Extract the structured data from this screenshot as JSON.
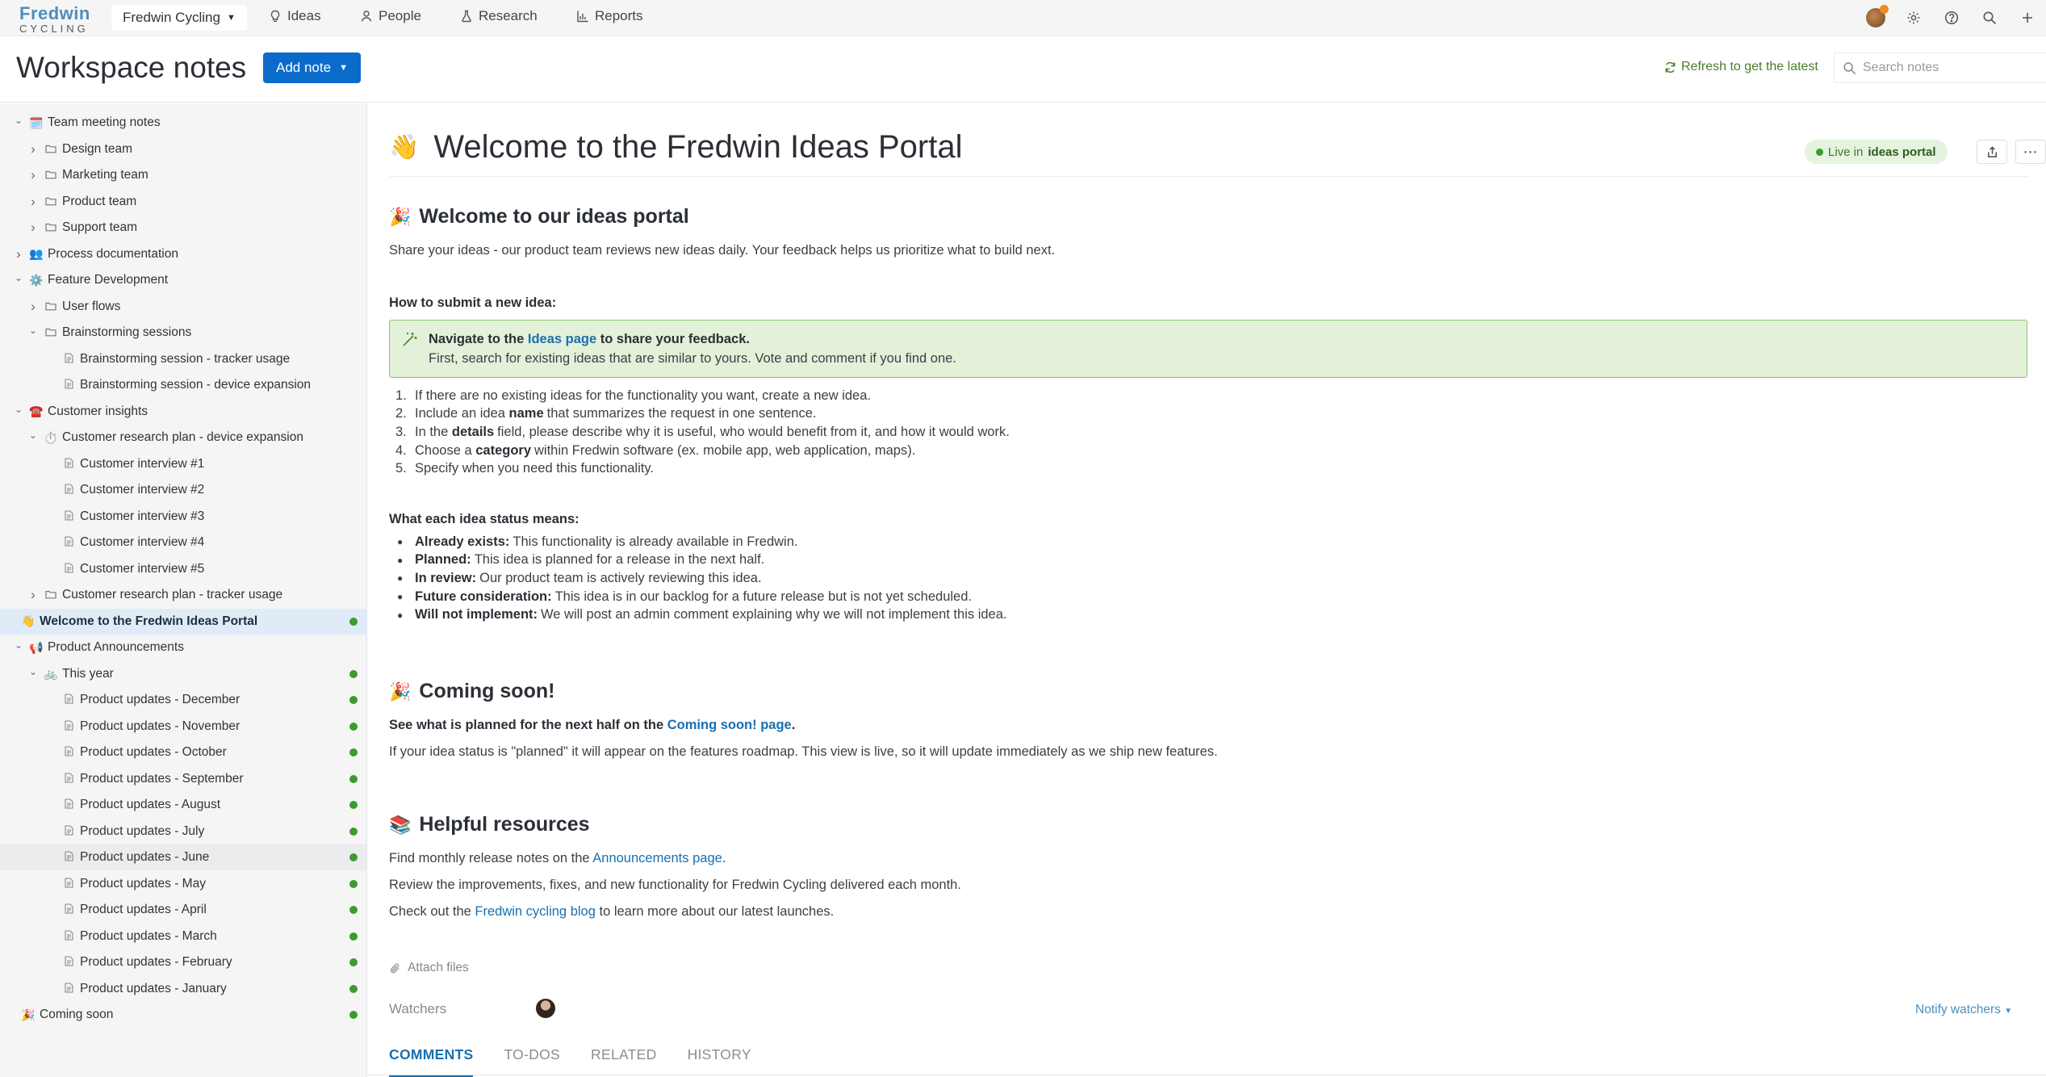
{
  "nav": {
    "logo_line1": "Fredwin",
    "logo_line2": "CYCLING",
    "workspace": "Fredwin Cycling",
    "items": [
      {
        "label": "Ideas",
        "icon": "lightbulb-icon"
      },
      {
        "label": "People",
        "icon": "person-icon"
      },
      {
        "label": "Research",
        "icon": "flask-icon"
      },
      {
        "label": "Reports",
        "icon": "bar-chart-icon"
      }
    ]
  },
  "header": {
    "title": "Workspace notes",
    "add_note": "Add note",
    "refresh": "Refresh to get the latest",
    "search_placeholder": "Search notes"
  },
  "sidebar": {
    "items": [
      {
        "label": "Team meeting notes",
        "level": 0,
        "chev": "down",
        "icon": "🗓️",
        "live": false
      },
      {
        "label": "Design team",
        "level": 1,
        "chev": "right",
        "icon": "folder",
        "live": false
      },
      {
        "label": "Marketing team",
        "level": 1,
        "chev": "right",
        "icon": "folder",
        "live": false
      },
      {
        "label": "Product team",
        "level": 1,
        "chev": "right",
        "icon": "folder",
        "live": false
      },
      {
        "label": "Support team",
        "level": 1,
        "chev": "right",
        "icon": "folder",
        "live": false
      },
      {
        "label": "Process documentation",
        "level": 0,
        "chev": "right",
        "icon": "👥",
        "live": false
      },
      {
        "label": "Feature Development",
        "level": 0,
        "chev": "down",
        "icon": "⚙️",
        "live": false
      },
      {
        "label": "User flows",
        "level": 1,
        "chev": "right",
        "icon": "folder",
        "live": false
      },
      {
        "label": "Brainstorming sessions",
        "level": 1,
        "chev": "down",
        "icon": "folder",
        "live": false
      },
      {
        "label": "Brainstorming session - tracker usage",
        "level": 2,
        "chev": "",
        "icon": "doc",
        "live": false
      },
      {
        "label": "Brainstorming session - device expansion",
        "level": 2,
        "chev": "",
        "icon": "doc",
        "live": false
      },
      {
        "label": "Customer insights",
        "level": 0,
        "chev": "down",
        "icon": "☎️",
        "live": false
      },
      {
        "label": "Customer research plan - device expansion",
        "level": 1,
        "chev": "down",
        "icon": "⏱️",
        "live": false
      },
      {
        "label": "Customer interview #1",
        "level": 2,
        "chev": "",
        "icon": "doc",
        "live": false
      },
      {
        "label": "Customer interview #2",
        "level": 2,
        "chev": "",
        "icon": "doc",
        "live": false
      },
      {
        "label": "Customer interview #3",
        "level": 2,
        "chev": "",
        "icon": "doc",
        "live": false
      },
      {
        "label": "Customer interview #4",
        "level": 2,
        "chev": "",
        "icon": "doc",
        "live": false
      },
      {
        "label": "Customer interview #5",
        "level": 2,
        "chev": "",
        "icon": "doc",
        "live": false
      },
      {
        "label": "Customer research plan - tracker usage",
        "level": 1,
        "chev": "right",
        "icon": "folder",
        "live": false
      },
      {
        "label": "Welcome to the Fredwin Ideas Portal",
        "level": 0,
        "chev": "",
        "icon": "👋",
        "live": true,
        "selected": true
      },
      {
        "label": "Product Announcements",
        "level": 0,
        "chev": "down",
        "icon": "📢",
        "live": false
      },
      {
        "label": "This year",
        "level": 1,
        "chev": "down",
        "icon": "🚲",
        "live": true
      },
      {
        "label": "Product updates - December",
        "level": 2,
        "chev": "",
        "icon": "doc",
        "live": true
      },
      {
        "label": "Product updates - November",
        "level": 2,
        "chev": "",
        "icon": "doc",
        "live": true
      },
      {
        "label": "Product updates - October",
        "level": 2,
        "chev": "",
        "icon": "doc",
        "live": true
      },
      {
        "label": "Product updates - September",
        "level": 2,
        "chev": "",
        "icon": "doc",
        "live": true
      },
      {
        "label": "Product updates - August",
        "level": 2,
        "chev": "",
        "icon": "doc",
        "live": true
      },
      {
        "label": "Product updates - July",
        "level": 2,
        "chev": "",
        "icon": "doc",
        "live": true
      },
      {
        "label": "Product updates - June",
        "level": 2,
        "chev": "",
        "icon": "doc",
        "live": true,
        "hover": true
      },
      {
        "label": "Product updates - May",
        "level": 2,
        "chev": "",
        "icon": "doc",
        "live": true
      },
      {
        "label": "Product updates - April",
        "level": 2,
        "chev": "",
        "icon": "doc",
        "live": true
      },
      {
        "label": "Product updates - March",
        "level": 2,
        "chev": "",
        "icon": "doc",
        "live": true
      },
      {
        "label": "Product updates - February",
        "level": 2,
        "chev": "",
        "icon": "doc",
        "live": true
      },
      {
        "label": "Product updates - January",
        "level": 2,
        "chev": "",
        "icon": "doc",
        "live": true
      },
      {
        "label": "Coming soon",
        "level": 0,
        "chev": "",
        "icon": "🎉",
        "live": true
      }
    ]
  },
  "doc": {
    "title_emoji": "👋",
    "title": "Welcome to the Fredwin Ideas Portal",
    "live_prefix": "Live in",
    "live_target": "ideas portal",
    "section1_emoji": "🎉",
    "section1": "Welcome to our ideas portal",
    "intro": "Share your ideas - our product team reviews new ideas daily. Your feedback helps us prioritize what to build next.",
    "how_heading": "How to submit a new idea:",
    "callout_pre": "Navigate to the",
    "callout_link": "Ideas page",
    "callout_post": "to share your feedback.",
    "callout_line2": "First, search for existing ideas that are similar to yours. Vote and comment if you find one.",
    "steps": [
      {
        "n": "1.",
        "pre": "If there are no existing ideas for the functionality you want, create a new idea.",
        "bold": "",
        "post": ""
      },
      {
        "n": "2.",
        "pre": "Include an idea",
        "bold": "name",
        "post": "that summarizes the request in one sentence."
      },
      {
        "n": "3.",
        "pre": "In the",
        "bold": "details",
        "post": "field, please describe why it is useful, who would benefit from it, and how it would work."
      },
      {
        "n": "4.",
        "pre": "Choose a",
        "bold": "category",
        "post": "within Fredwin software (ex. mobile app, web application, maps)."
      },
      {
        "n": "5.",
        "pre": "Specify when you need this functionality.",
        "bold": "",
        "post": ""
      }
    ],
    "status_heading": "What each idea status means:",
    "statuses": [
      {
        "term": "Already exists:",
        "desc": "This functionality is already available in Fredwin."
      },
      {
        "term": "Planned:",
        "desc": "This idea is planned for a release in the next half."
      },
      {
        "term": "In review:",
        "desc": "Our product team is actively reviewing this idea."
      },
      {
        "term": "Future consideration:",
        "desc": "This idea is in our backlog for a future release but is not yet scheduled."
      },
      {
        "term": "Will not implement:",
        "desc": "We will post an admin comment explaining why we will not implement this idea."
      }
    ],
    "section2_emoji": "🎉",
    "section2": "Coming soon!",
    "coming_pre": "See what is planned for the next half on the",
    "coming_link": "Coming soon! page",
    "coming_post": ".",
    "coming_line2": "If your idea status is \"planned\" it will appear on the features roadmap. This view is live, so it will update immediately as we ship new features.",
    "section3_emoji": "📚",
    "section3": "Helpful resources",
    "res1_pre": "Find monthly release notes on the",
    "res1_link": "Announcements page",
    "res1_post": ".",
    "res2": "Review the improvements, fixes, and new functionality for Fredwin Cycling delivered each month.",
    "res3_pre": "Check out the",
    "res3_link": "Fredwin cycling blog",
    "res3_post": "to learn more about our latest launches.",
    "attach": "Attach files",
    "watchers": "Watchers",
    "notify": "Notify watchers",
    "tabs": [
      "COMMENTS",
      "TO-DOS",
      "RELATED",
      "HISTORY"
    ]
  }
}
